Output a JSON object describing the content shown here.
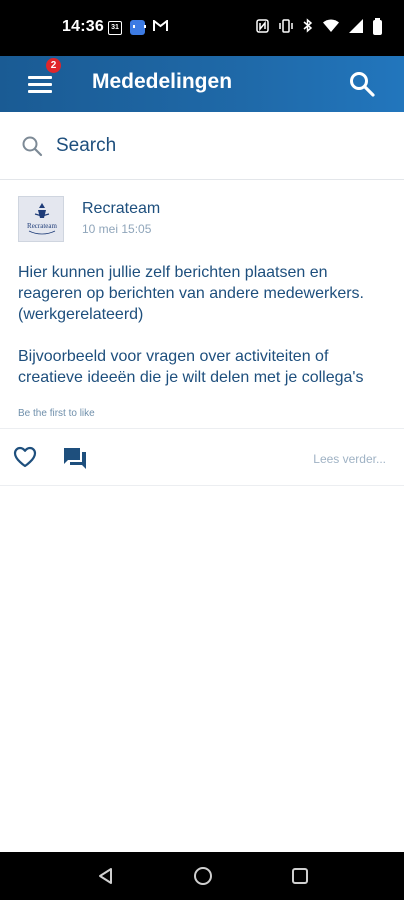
{
  "status_bar": {
    "time": "14:36",
    "calendar_icon_text": "31",
    "left_icons": [
      "calendar-icon",
      "chat-app-icon",
      "gmail-icon"
    ],
    "right_icons": [
      "nfc-icon",
      "vibrate-icon",
      "bluetooth-icon",
      "wifi-icon",
      "signal-icon",
      "battery-icon"
    ]
  },
  "app_bar": {
    "title": "Mededelingen",
    "notification_count": "2"
  },
  "search": {
    "placeholder": "Search"
  },
  "post": {
    "author": "Recrateam",
    "date": "10 mei 15:05",
    "paragraphs": [
      "Hier kunnen jullie zelf berichten plaatsen en reageren op berichten van andere medewerkers. (werkgerelateerd)",
      "Bijvoorbeeld voor vragen over activiteiten of creatieve ideeën die je wilt delen met je collega's"
    ],
    "likes_text": "Be the first to like",
    "read_more": "Lees verder..."
  },
  "colors": {
    "app_bar": "#1f69a8",
    "text_primary": "#1e4f7d",
    "badge": "#e0262b"
  }
}
